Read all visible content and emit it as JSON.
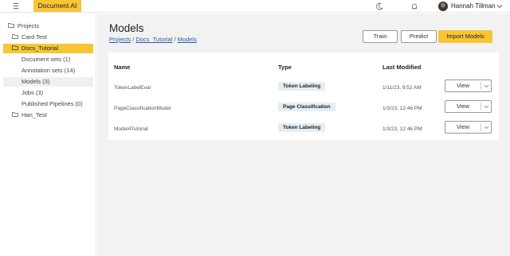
{
  "topbar": {
    "app_name": "Document AI",
    "user_name": "Hannah Tillman",
    "icons": [
      "menu-icon",
      "moon-icon",
      "bell-icon",
      "avatar",
      "chevron-down-icon"
    ],
    "accent_color": "#f8c535"
  },
  "sidebar": {
    "items": [
      {
        "label": "Projects"
      },
      {
        "label": "Card Test"
      },
      {
        "label": "Docs_Tutorial"
      },
      {
        "label": "Document sets (1)"
      },
      {
        "label": "Annotation sets (14)"
      },
      {
        "label": "Models (3)"
      },
      {
        "label": "Jobs (3)"
      },
      {
        "label": "Published Pipelines (0)"
      },
      {
        "label": "Han_Test"
      }
    ]
  },
  "main": {
    "title": "Models",
    "breadcrumb": {
      "projects": "Projects",
      "sep1": "/",
      "tutorial": "Docs_Tutorial",
      "sep2": "/",
      "models": "Models"
    },
    "buttons": {
      "train": "Train",
      "predict": "Predict",
      "import": "Import Models"
    },
    "table": {
      "headers": {
        "name": "Name",
        "type": "Type",
        "modified": "Last Modified"
      },
      "rows": [
        {
          "name": "TokenLabelEval",
          "type": "Token Labeling",
          "modified": "1/11/23, 9:52 AM",
          "action": "View"
        },
        {
          "name": "PageClassificationModel",
          "type": "Page Classification",
          "modified": "1/3/23, 12:46 PM",
          "action": "View"
        },
        {
          "name": "Model4Tutorial",
          "type": "Token Labeling",
          "modified": "1/3/23, 12:46 PM",
          "action": "View"
        }
      ]
    }
  }
}
